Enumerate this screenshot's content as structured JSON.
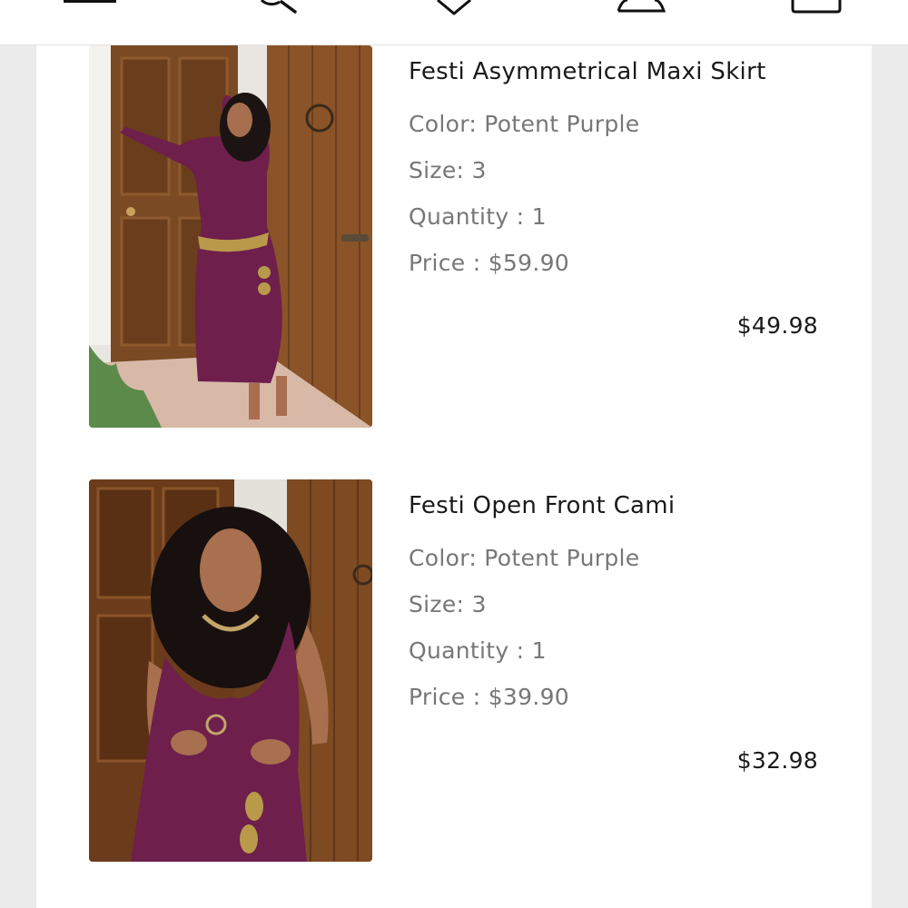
{
  "nav": {
    "icons": [
      "menu-icon",
      "search-icon",
      "wishlist-heart-icon",
      "account-icon",
      "cart-icon"
    ]
  },
  "cart": {
    "items": [
      {
        "name": "Festi Asymmetrical Maxi Skirt",
        "color": "Color: Potent Purple",
        "size": "Size: 3",
        "quantity": "Quantity : 1",
        "price": "Price : $59.90",
        "total": "$49.98",
        "image_alt": "Model in purple lace maxi skirt and cami standing by wooden doors"
      },
      {
        "name": "Festi Open Front Cami",
        "color": "Color: Potent Purple",
        "size": "Size: 3",
        "quantity": "Quantity : 1",
        "price": "Price : $39.90",
        "total": "$32.98",
        "image_alt": "Model in purple lace open front cami in front of wooden door"
      }
    ]
  },
  "colors": {
    "product_purple": "#6e1f4c",
    "wood": "#7a4a24",
    "text_dark": "#1a1a1a",
    "text_muted": "#777777"
  }
}
